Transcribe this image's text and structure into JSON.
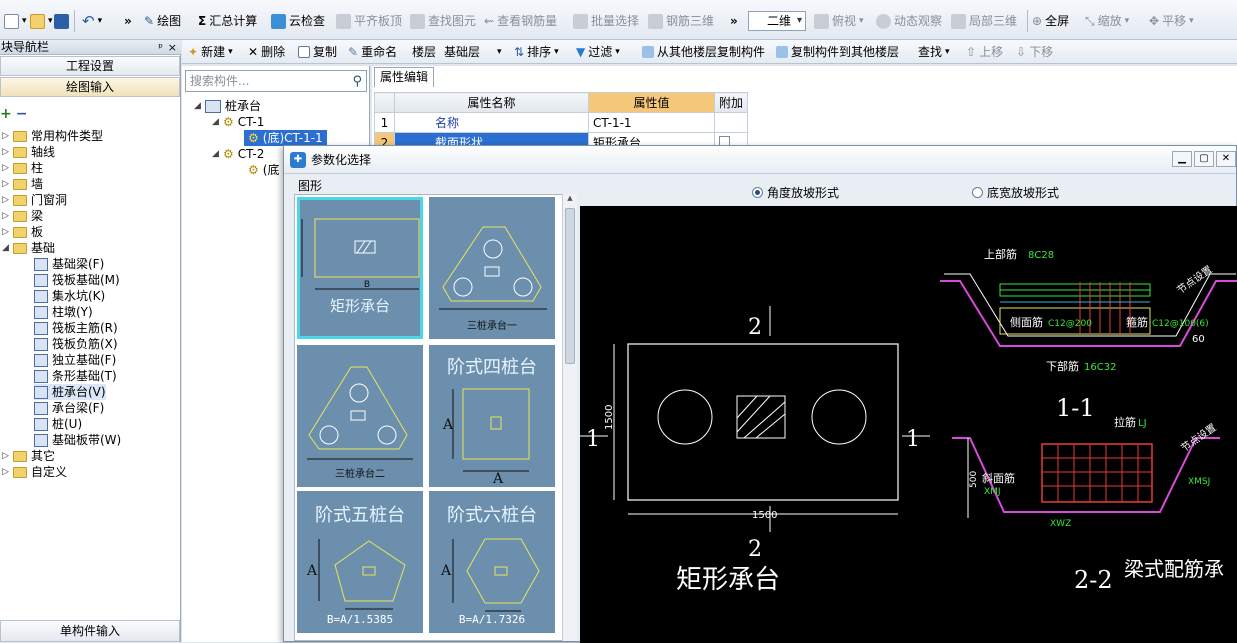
{
  "toolbar": {
    "more1": "»",
    "draw": "绘图",
    "sum_calc": "汇总计算",
    "cloud_check": "云检查",
    "align_slab": "平齐板顶",
    "find_elem": "查找图元",
    "view_rebar": "查看钢筋量",
    "batch_select": "批量选择",
    "rebar_3d": "钢筋三维",
    "more2": "»",
    "view_mode": "二维",
    "top_view": "俯视",
    "dynamic_view": "动态观察",
    "local_3d": "局部三维",
    "fullscreen": "全屏",
    "zoom": "缩放",
    "pan": "平移"
  },
  "nav": {
    "title": "块导航栏",
    "pin": "ᵖ",
    "close": "×",
    "btn_project": "工程设置",
    "btn_draw_input": "绘图输入",
    "tree": [
      {
        "label": "常用构件类型",
        "open": false
      },
      {
        "label": "轴线",
        "open": false
      },
      {
        "label": "柱",
        "open": false
      },
      {
        "label": "墙",
        "open": false
      },
      {
        "label": "门窗洞",
        "open": false
      },
      {
        "label": "梁",
        "open": false
      },
      {
        "label": "板",
        "open": false
      },
      {
        "label": "基础",
        "open": true
      }
    ],
    "foundation_children": [
      "基础梁(F)",
      "筏板基础(M)",
      "集水坑(K)",
      "柱墩(Y)",
      "筏板主筋(R)",
      "筏板负筋(X)",
      "独立基础(F)",
      "条形基础(T)",
      "桩承台(V)",
      "承台梁(F)",
      "桩(U)",
      "基础板带(W)"
    ],
    "tree_after": [
      "其它",
      "自定义"
    ],
    "bottom_btn": "单构件输入"
  },
  "component_tree": {
    "search_placeholder": "搜索构件...",
    "root": "桩承台",
    "ct1": "CT-1",
    "ct1_child": "(底)CT-1-1",
    "ct2": "CT-2",
    "ct2_child": "(底"
  },
  "toolbar2": {
    "new": "新建",
    "delete": "删除",
    "copy": "复制",
    "rename": "重命名",
    "floor_label": "楼层",
    "floor_value": "基础层",
    "sort": "排序",
    "filter": "过滤",
    "copy_from": "从其他楼层复制构件",
    "copy_to": "复制构件到其他楼层",
    "find": "查找",
    "move_up": "上移",
    "move_down": "下移"
  },
  "props": {
    "tab": "属性编辑",
    "col_name": "属性名称",
    "col_value": "属性值",
    "col_extra": "附加",
    "rows": [
      {
        "idx": "1",
        "name": "名称",
        "value": "CT-1-1"
      },
      {
        "idx": "2",
        "name": "截面形状",
        "value": "矩形承台"
      }
    ]
  },
  "dialog": {
    "title": "参数化选择",
    "shapes_label": "图形",
    "radio1": "角度放坡形式",
    "radio2": "底宽放坡形式",
    "thumbs": {
      "t1": "矩形承台",
      "t1_b": "B",
      "t2": "三桩承台一",
      "t3": "三桩承台二",
      "t4": "阶式四桩台",
      "t4_a": "A",
      "t5": "阶式五桩台",
      "t5_b": "B=A/1.5385",
      "t6": "阶式六桩台",
      "t6_b": "B=A/1.7326",
      "axis_a": "A"
    },
    "cad": {
      "sec2_top": "2",
      "sec2_bottom": "2",
      "sec1_left": "1",
      "sec1_right": "1",
      "dim_h": "1500",
      "dim_v": "1500",
      "plan_title": "矩形承台",
      "top_rebar": "上部筋",
      "top_rebar_val": "8C28",
      "side_rebar": "侧面筋",
      "side_rebar_val": "C12@200",
      "stirrup": "箍筋",
      "stirrup_val": "C12@100(6)",
      "bottom_rebar": "下部筋",
      "bottom_rebar_val": "16C32",
      "angle": "60",
      "sec11": "1-1",
      "node_setting": "节点设置",
      "tie": "拉筋",
      "tie_val": "LJ",
      "slope_rebar": "斜面筋",
      "slope_val": "XMJ",
      "xmsj": "XMSJ",
      "xwz": "XWZ",
      "dim500": "500",
      "sec22": "2-2",
      "beam_title": "梁式配筋承"
    }
  }
}
